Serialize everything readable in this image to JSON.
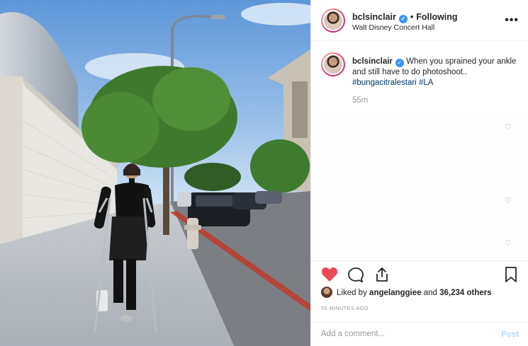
{
  "post": {
    "username": "bclsinclair",
    "follow_separator": "•",
    "follow_label": "Following",
    "location": "Walt Disney Concert Hall",
    "more_icon": "more-dots-icon",
    "caption_username": "bclsinclair",
    "caption_text": "When you sprained your ankle and still have to do photoshoot..",
    "hashtags": [
      "#bungacitralestari",
      "#LA"
    ],
    "caption_time": "55m",
    "likes_prefix": "Liked by",
    "likes_user": "angelanggiee",
    "likes_and": "and",
    "likes_count": "36,234 others",
    "posted_ago": "55 MINUTES AGO",
    "comment_placeholder": "Add a comment...",
    "post_label": "Post"
  },
  "icons": [
    "heart-icon",
    "comment-icon",
    "share-icon",
    "bookmark-icon",
    "verified-icon",
    "small-heart-icon"
  ],
  "colors": {
    "heart": "#ed4956",
    "link": "#003569",
    "verified": "#3897f0",
    "muted": "#999999",
    "post_disabled": "#b2dffc"
  }
}
